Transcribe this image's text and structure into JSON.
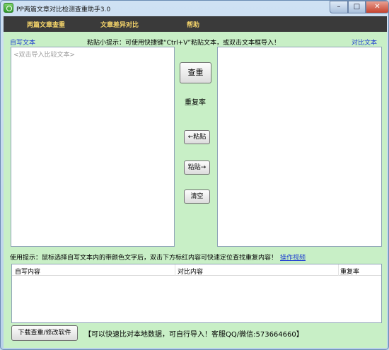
{
  "window": {
    "title": "PP两篇文章对比检测查重助手3.0",
    "controls": {
      "minimize": "–",
      "maximize": "□",
      "close": "✕"
    }
  },
  "menu": {
    "items": [
      "两篇文章查重",
      "文章差异对比",
      "帮助"
    ]
  },
  "left_panel": {
    "label": "自写文本",
    "placeholder": "<双击导入比较文本>"
  },
  "paste_tip": "粘贴小提示：可使用快捷键“Ctrl+V”粘贴文本，或双击文本框导入！",
  "right_panel": {
    "label": "对比文本"
  },
  "center": {
    "check_button": "查重",
    "rate_label": "重复率",
    "paste_left_button": "←粘贴",
    "paste_right_button": "粘贴→",
    "clear_button": "清空"
  },
  "usage_tip": {
    "text": "使用提示：鼠标选择自写文本内的带颜色文字后，双击下方标红内容可快速定位查找重复内容！",
    "link": "操作视频"
  },
  "results_table": {
    "columns": [
      "自写内容",
      "对比内容",
      "重复率"
    ],
    "rows": []
  },
  "footer": {
    "download_button": "下载查重/修改软件",
    "note": "【可以快速比对本地数据，可自行导入！客服QQ/微信:573664660】"
  },
  "colors": {
    "client_background": "#c8efc6",
    "menubar_background": "#3a3a3a",
    "menu_text": "#f3d36a",
    "accent_blue": "#1f3fd1"
  }
}
